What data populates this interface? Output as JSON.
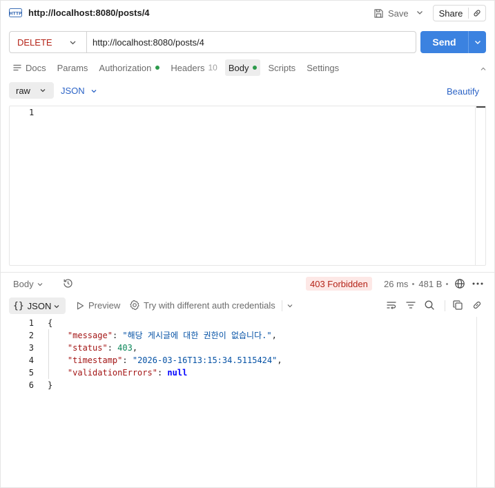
{
  "header": {
    "title": "http://localhost:8080/posts/4",
    "save_label": "Save",
    "share_label": "Share"
  },
  "request": {
    "method": "DELETE",
    "url": "http://localhost:8080/posts/4",
    "send_label": "Send"
  },
  "tabs": [
    {
      "label": "Docs"
    },
    {
      "label": "Params"
    },
    {
      "label": "Authorization",
      "dot": true
    },
    {
      "label": "Headers",
      "count": "10"
    },
    {
      "label": "Body",
      "dot": true,
      "active": true
    },
    {
      "label": "Scripts"
    },
    {
      "label": "Settings"
    }
  ],
  "body_bar": {
    "mode": "raw",
    "language": "JSON",
    "beautify_label": "Beautify"
  },
  "request_editor": {
    "line_numbers": [
      "1"
    ]
  },
  "response": {
    "view_label": "Body",
    "status": "403 Forbidden",
    "time": "26 ms",
    "size": "481 B",
    "format_label": "JSON",
    "braces": "{}",
    "preview_label": "Preview",
    "try_auth_label": "Try with different auth credentials",
    "lines": [
      {
        "num": "1",
        "parts": [
          {
            "t": "{",
            "c": "p"
          }
        ]
      },
      {
        "num": "2",
        "parts": [
          {
            "t": "    ",
            "c": "p"
          },
          {
            "t": "\"message\"",
            "c": "k"
          },
          {
            "t": ": ",
            "c": "p"
          },
          {
            "t": "\"해당 게시글에 대한 권한이 없습니다.\"",
            "c": "s"
          },
          {
            "t": ",",
            "c": "p"
          }
        ]
      },
      {
        "num": "3",
        "parts": [
          {
            "t": "    ",
            "c": "p"
          },
          {
            "t": "\"status\"",
            "c": "k"
          },
          {
            "t": ": ",
            "c": "p"
          },
          {
            "t": "403",
            "c": "n"
          },
          {
            "t": ",",
            "c": "p"
          }
        ]
      },
      {
        "num": "4",
        "parts": [
          {
            "t": "    ",
            "c": "p"
          },
          {
            "t": "\"timestamp\"",
            "c": "k"
          },
          {
            "t": ": ",
            "c": "p"
          },
          {
            "t": "\"2026-03-16T13:15:34.5115424\"",
            "c": "s"
          },
          {
            "t": ",",
            "c": "p"
          }
        ]
      },
      {
        "num": "5",
        "parts": [
          {
            "t": "    ",
            "c": "p"
          },
          {
            "t": "\"validationErrors\"",
            "c": "k"
          },
          {
            "t": ": ",
            "c": "p"
          },
          {
            "t": "null",
            "c": "kw"
          }
        ]
      },
      {
        "num": "6",
        "parts": [
          {
            "t": "}",
            "c": "p"
          }
        ]
      }
    ]
  },
  "colors": {
    "accent": "#3b82e0",
    "method_delete": "#b42318",
    "status_error_bg": "#fde8e6",
    "link": "#2b63c6",
    "dot_green": "#2c9a4b"
  },
  "icons": [
    "http-icon",
    "save-icon",
    "chevron-down-icon",
    "link-icon",
    "chevron-up-icon",
    "history-icon",
    "globe-icon",
    "more-icon",
    "play-icon",
    "gear-icon",
    "wrap-icon",
    "filter-icon",
    "search-icon",
    "copy-icon"
  ]
}
